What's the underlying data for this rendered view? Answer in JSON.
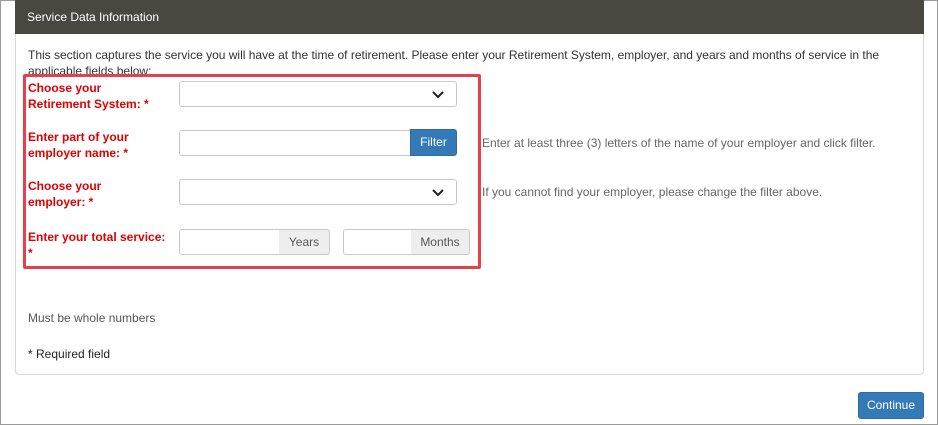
{
  "panel": {
    "title": "Service Data Information",
    "intro": "This section captures the service you will have at the time of retirement. Please enter your Retirement System, employer, and years and months of service in the applicable fields below:"
  },
  "form": {
    "retirement_system": {
      "label_line1": "Choose your",
      "label_line2": "Retirement System: *",
      "selected_value": ""
    },
    "employer_name": {
      "label_line1": "Enter part of your",
      "label_line2": "employer name: *",
      "value": "",
      "filter_label": "Filter",
      "help": "Enter at least three (3) letters of the name of your employer and click filter."
    },
    "employer": {
      "label_line1": "Choose your",
      "label_line2": "employer: *",
      "selected_value": "",
      "help": "If you cannot find your employer, please change the filter above."
    },
    "total_service": {
      "label_line1": "Enter your total service:",
      "label_line2": "*",
      "years_value": "",
      "years_addon": "Years",
      "months_value": "",
      "months_addon": "Months"
    }
  },
  "notes": {
    "whole_numbers": "Must be whole numbers",
    "required": "* Required field"
  },
  "actions": {
    "continue_label": "Continue"
  },
  "colors": {
    "heading_bg": "#4a4640",
    "label_red": "#e00000",
    "highlight_border": "#e8404a",
    "primary_button": "#337ab7"
  },
  "icons": {
    "dropdown": "chevron-down-icon"
  }
}
